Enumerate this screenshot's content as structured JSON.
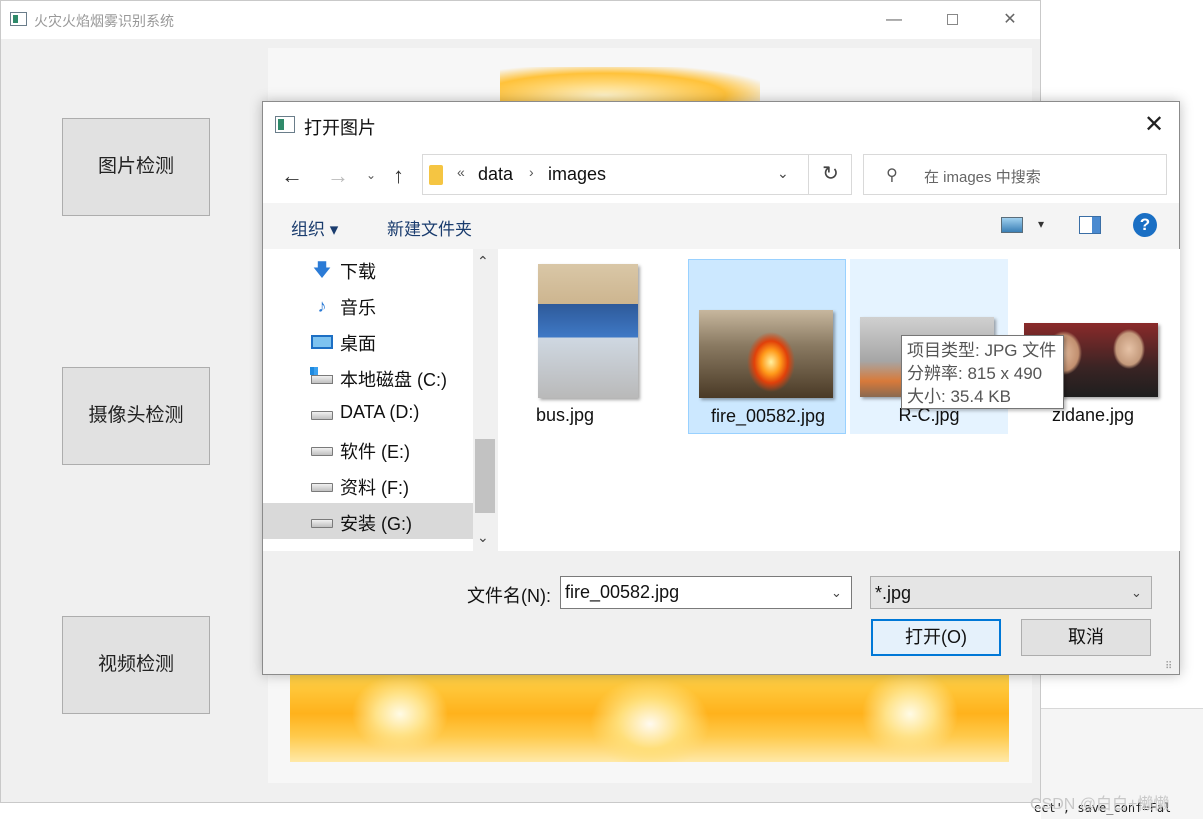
{
  "app": {
    "title": "火灾火焰烟雾识别系统",
    "minimize": "—",
    "close": "✕",
    "buttons": {
      "image_detect": "图片检测",
      "camera_detect": "摄像头检测",
      "video_detect": "视频检测"
    }
  },
  "dialog": {
    "title": "打开图片",
    "close": "✕",
    "nav": {
      "back": "←",
      "forward": "→",
      "recent": "⌄",
      "up": "↑"
    },
    "address": {
      "overflow": "«",
      "separator": "›",
      "parts": [
        "data",
        "images"
      ],
      "dropdown": "⌄",
      "refresh": "↻"
    },
    "search": {
      "placeholder": "在 images 中搜索"
    },
    "toolbar": {
      "organize": "组织 ▾",
      "new_folder": "新建文件夹",
      "view_drop": "▾",
      "help": "?"
    },
    "sidebar": {
      "items": [
        {
          "label": "下载",
          "icon": "download-icon"
        },
        {
          "label": "音乐",
          "icon": "music-icon"
        },
        {
          "label": "桌面",
          "icon": "desktop-icon"
        },
        {
          "label": "本地磁盘 (C:)",
          "icon": "system-drive-icon"
        },
        {
          "label": "DATA (D:)",
          "icon": "drive-icon"
        },
        {
          "label": "软件 (E:)",
          "icon": "drive-icon"
        },
        {
          "label": "资料 (F:)",
          "icon": "drive-icon"
        },
        {
          "label": "安装 (G:)",
          "icon": "drive-icon",
          "selected": true
        }
      ],
      "scroll_up": "⌃",
      "scroll_down": "⌄"
    },
    "files": [
      {
        "name": "bus.jpg"
      },
      {
        "name": "fire_00582.jpg",
        "selected": true
      },
      {
        "name": "R-C.jpg",
        "hover": true
      },
      {
        "name": "zidane.jpg"
      }
    ],
    "tooltip": {
      "type": "项目类型: JPG 文件",
      "resolution": "分辨率: 815 x 490",
      "size": "大小: 35.4 KB"
    },
    "filename_label": "文件名(N):",
    "filename_value": "fire_00582.jpg",
    "filename_drop": "⌄",
    "filter_value": "*.jpg",
    "filter_drop": "⌄",
    "open_button": "打开(O)",
    "cancel_button": "取消"
  },
  "background": {
    "code_tail": "ect', save_conf=Fal",
    "watermark": "CSDN @白白+懒懒"
  }
}
